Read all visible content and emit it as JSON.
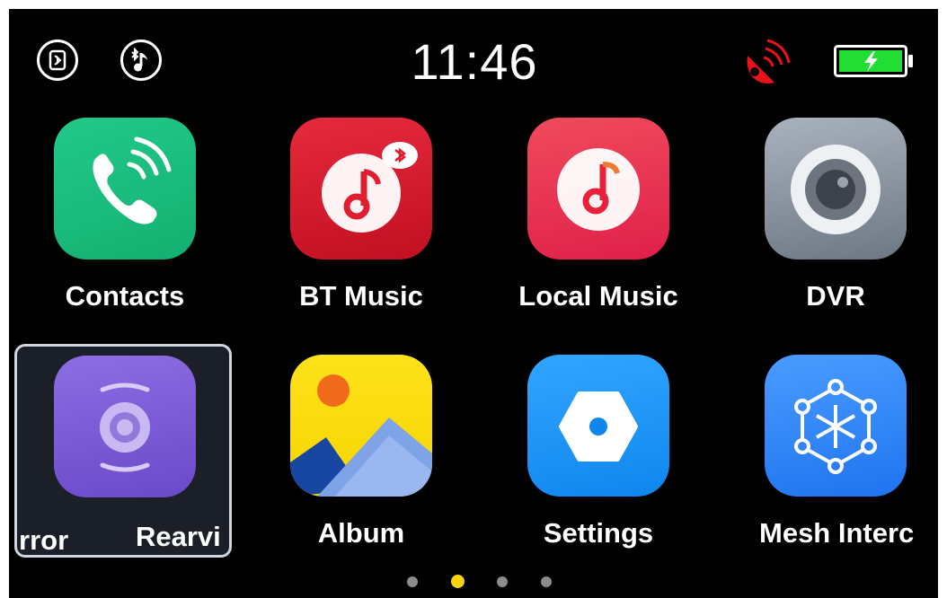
{
  "status": {
    "time": "11:46",
    "battery_color": "#22dd33",
    "signal_color": "#e8131a"
  },
  "apps": [
    {
      "label": "Contacts",
      "icon": "phone-icon"
    },
    {
      "label": "BT Music",
      "icon": "bt-music-icon"
    },
    {
      "label": "Local Music",
      "icon": "music-note-icon"
    },
    {
      "label": "DVR",
      "icon": "camera-lens-icon"
    },
    {
      "label_left": "rror",
      "label_right": "Rearvi",
      "icon": "rearview-camera-icon",
      "selected": true
    },
    {
      "label": "Album",
      "icon": "image-icon"
    },
    {
      "label": "Settings",
      "icon": "hexagon-settings-icon"
    },
    {
      "label": "Mesh Interc",
      "icon": "mesh-network-icon"
    }
  ],
  "pager": {
    "count": 4,
    "active": 2
  }
}
